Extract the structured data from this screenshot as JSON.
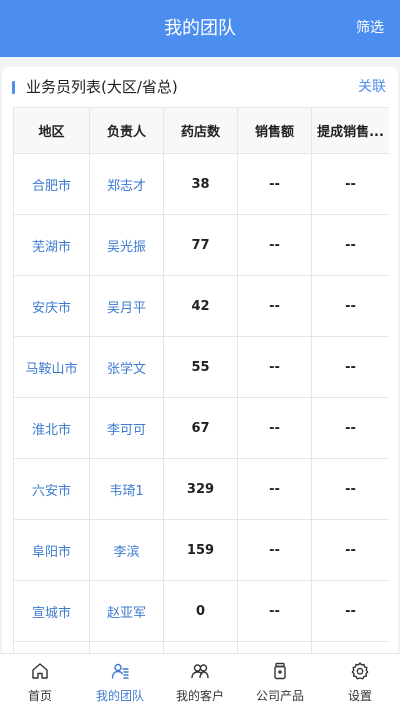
{
  "header": {
    "title": "我的团队",
    "filter_label": "筛选"
  },
  "section": {
    "title": "业务员列表(大区/省总)",
    "link_label": "关联"
  },
  "table": {
    "columns": [
      "地区",
      "负责人",
      "药店数",
      "销售额",
      "提成销售..."
    ],
    "rows": [
      [
        "合肥市",
        "郑志才",
        "38",
        "--",
        "--"
      ],
      [
        "芜湖市",
        "吴光振",
        "77",
        "--",
        "--"
      ],
      [
        "安庆市",
        "吴月平",
        "42",
        "--",
        "--"
      ],
      [
        "马鞍山市",
        "张学文",
        "55",
        "--",
        "--"
      ],
      [
        "淮北市",
        "李可可",
        "67",
        "--",
        "--"
      ],
      [
        "六安市",
        "韦琦1",
        "329",
        "--",
        "--"
      ],
      [
        "阜阳市",
        "李滨",
        "159",
        "--",
        "--"
      ],
      [
        "宣城市",
        "赵亚军",
        "0",
        "--",
        "--"
      ],
      [
        "",
        "",
        "",
        "",
        ""
      ]
    ]
  },
  "tabbar": {
    "items": [
      {
        "label": "首页",
        "icon": "home-icon"
      },
      {
        "label": "我的团队",
        "icon": "team-icon",
        "active": true
      },
      {
        "label": "我的客户",
        "icon": "customers-icon"
      },
      {
        "label": "公司产品",
        "icon": "products-icon"
      },
      {
        "label": "设置",
        "icon": "settings-icon"
      }
    ]
  },
  "colors": {
    "accent": "#4b8ef0",
    "link": "#3e7bd0"
  }
}
